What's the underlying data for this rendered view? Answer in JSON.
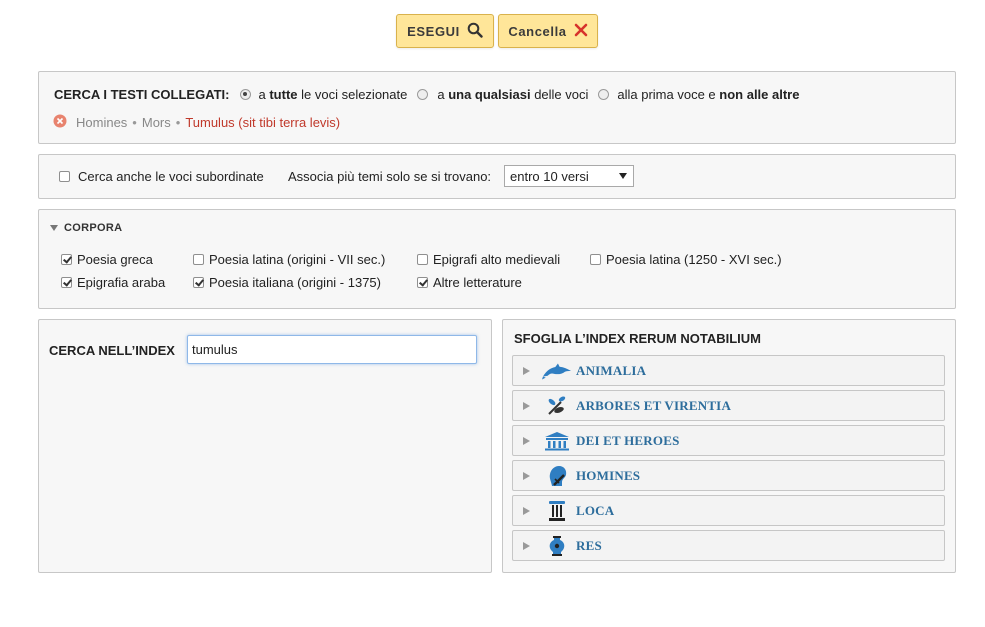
{
  "toolbar": {
    "run_label": "ESEGUI",
    "cancel_label": "Cancella"
  },
  "linked": {
    "heading": "CERCA I TESTI COLLEGATI:",
    "options": [
      {
        "pre": "a ",
        "bold": "tutte",
        "post": " le voci selezionate",
        "selected": true
      },
      {
        "pre": "a ",
        "bold": "una qualsiasi",
        "post": " delle voci",
        "selected": false
      },
      {
        "pre": "alla prima voce e ",
        "bold": "non alle altre",
        "post": "",
        "selected": false
      }
    ],
    "path": {
      "items": [
        "Homines",
        "Mors"
      ],
      "separator": "•",
      "current": "Tumulus (sit tibi terra levis)"
    }
  },
  "options_bar": {
    "subordinate_label": "Cerca anche le voci subordinate",
    "subordinate_checked": false,
    "associate_label": "Associa più temi solo se si trovano:",
    "range_value": "entro 10 versi"
  },
  "corpora": {
    "heading": "CORPORA",
    "items": [
      {
        "label": "Poesia greca",
        "checked": true
      },
      {
        "label": "Poesia latina (origini - VII sec.)",
        "checked": false
      },
      {
        "label": "Epigrafi alto medievali",
        "checked": false
      },
      {
        "label": "Poesia latina (1250 - XVI sec.)",
        "checked": false
      },
      {
        "label": "Epigrafia araba",
        "checked": true
      },
      {
        "label": "Poesia italiana (origini - 1375)",
        "checked": true
      },
      {
        "label": "Altre letterature",
        "checked": true
      }
    ]
  },
  "index_search": {
    "label": "CERCA NELL’INDEX",
    "value": "tumulus"
  },
  "index_browse": {
    "heading": "SFOGLIA L’INDEX RERUM NOTABILIUM",
    "items": [
      {
        "label": "ANIMALIA",
        "icon": "dolphin-icon"
      },
      {
        "label": "ARBORES ET VIRENTIA",
        "icon": "plant-icon"
      },
      {
        "label": "DEI ET HEROES",
        "icon": "temple-icon"
      },
      {
        "label": "HOMINES",
        "icon": "human-head-icon"
      },
      {
        "label": "LOCA",
        "icon": "column-icon"
      },
      {
        "label": "RES",
        "icon": "vase-icon"
      }
    ]
  },
  "colors": {
    "button_bg": "#ffe699",
    "link_red": "#c0392b",
    "index_blue": "#2d6d9c"
  }
}
